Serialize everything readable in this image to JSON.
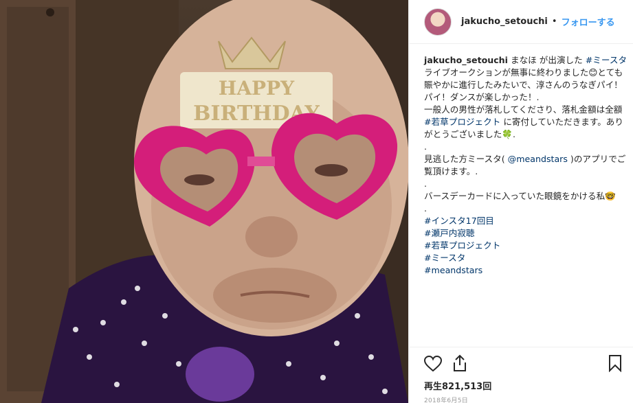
{
  "post": {
    "username": "jakucho_setouchi",
    "separator": "•",
    "follow_label": "フォローする",
    "media_overlay_text": "HAPPY BIRTHDAY"
  },
  "caption": {
    "username": "jakucho_setouchi",
    "line1_text": "まなほ が出演した ",
    "line1_tag": "#ミースタ",
    "line1_rest": " ライブオークションが無事に終わりました😊とても賑やかに進行したみたいで、淳さんのうなぎパイ！パイ！ダンスが楽しかった！.",
    "line2": "一般人の男性が落札してくださり、落札金額は全額 ",
    "line2_tag": "#若草プロジェクト",
    "line2_rest": " に寄付していただきます。ありがとうございました🍀.",
    "dot1": ".",
    "line3_a": "見逃した方ミースタ( ",
    "line3_mention": "@meandstars",
    "line3_b": " )のアプリでご覧頂けます。.",
    "dot2": ".",
    "line4": "バースデーカードに入っていた眼鏡をかける私🤓",
    "dot3": ".",
    "tags": [
      "#インスタ17回目",
      "#瀬戸内寂聴",
      "#若草プロジェクト",
      "#ミースタ",
      "#meandstars"
    ]
  },
  "footer": {
    "views": "再生821,513回",
    "date": "2018年6月5日"
  },
  "icons": {
    "like": "heart-icon",
    "share": "share-icon",
    "save": "bookmark-icon"
  },
  "colors": {
    "link": "#3897f0",
    "hashtag": "#003569",
    "glasses": "#d41e7a"
  }
}
